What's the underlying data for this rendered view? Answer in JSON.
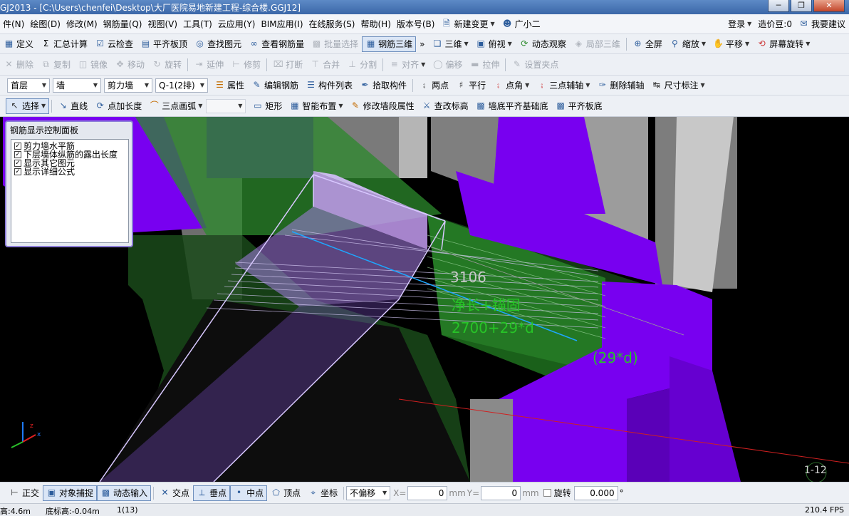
{
  "window": {
    "title": "GJ2013 - [C:\\Users\\chenfei\\Desktop\\大厂医院易地新建工程-综合楼.GGJ12]"
  },
  "menu": {
    "items": [
      "件(N)",
      "绘图(D)",
      "修改(M)",
      "钢筋量(Q)",
      "视图(V)",
      "工具(T)",
      "云应用(Y)",
      "BIM应用(I)",
      "在线服务(S)",
      "帮助(H)",
      "版本号(B)"
    ],
    "new_change": "新建变更",
    "xiaoer": "广小二",
    "login": "登录",
    "cost_beans": "造价豆:0",
    "want_suggest": "我要建议"
  },
  "toolbar1": {
    "define": "定义",
    "sum_calc": "汇总计算",
    "cloud_check": "云检查",
    "flush_top": "平齐板顶",
    "find_element": "查找图元",
    "view_rebar": "查看钢筋量",
    "batch_select": "批量选择",
    "rebar_3d": "钢筋三维",
    "more": "»",
    "three_d": "三维",
    "top_view": "俯视",
    "dynamic_view": "动态观察",
    "local_3d": "局部三维",
    "fullscreen": "全屏",
    "zoom": "缩放",
    "pan": "平移",
    "screen_rotate": "屏幕旋转"
  },
  "toolbar2": {
    "delete": "删除",
    "copy": "复制",
    "mirror": "镜像",
    "move": "移动",
    "rotate": "旋转",
    "extend": "延伸",
    "trim": "修剪",
    "break": "打断",
    "merge": "合并",
    "split": "分割",
    "align": "对齐",
    "offset": "偏移",
    "stretch": "拉伸",
    "set_grip": "设置夹点"
  },
  "toolbar3": {
    "floor": "首层",
    "category": "墙",
    "type": "剪力墙",
    "element": "Q-1(2排)",
    "property": "属性",
    "edit_rebar": "编辑钢筋",
    "element_list": "构件列表",
    "pick_element": "拾取构件",
    "two_points": "两点",
    "parallel": "平行",
    "point_angle": "点角",
    "three_point_axis": "三点辅轴",
    "delete_axis": "删除辅轴",
    "dimension": "尺寸标注"
  },
  "toolbar4": {
    "select": "选择",
    "line": "直线",
    "point_length": "点加长度",
    "three_point_arc": "三点画弧",
    "rect": "矩形",
    "smart_layout": "智能布置",
    "modify_segment": "修改墙段属性",
    "check_elevation": "查改标高",
    "wall_bottom_align": "墙底平齐基础底",
    "align_slab_bottom": "平齐板底"
  },
  "control_panel": {
    "title": "钢筋显示控制面板",
    "options": [
      {
        "label": "剪力墙水平筋",
        "checked": true
      },
      {
        "label": "下层墙体纵筋的露出长度",
        "checked": true
      },
      {
        "label": "显示其它图元",
        "checked": true
      },
      {
        "label": "显示详细公式",
        "checked": true
      }
    ]
  },
  "viewport": {
    "len_value": "3106",
    "formula_name": "净长+锚固",
    "formula_value": "2700+29*d",
    "anchor_label": "(29*d)",
    "view_id": "1-12"
  },
  "snapbar": {
    "ortho": "正交",
    "object_snap": "对象捕捉",
    "dynamic_input": "动态输入",
    "intersection": "交点",
    "perpendicular": "垂点",
    "midpoint": "中点",
    "vertex": "顶点",
    "coordinate": "坐标",
    "offset_mode": "不偏移",
    "x_label": "X=",
    "x_value": "0",
    "x_unit": "mm",
    "y_label": "Y=",
    "y_value": "0",
    "y_unit": "mm",
    "rotate": "旋转",
    "rotate_value": "0.000",
    "deg": "°"
  },
  "status": {
    "height": "高:4.6m",
    "bottom_elev": "底标高:-0.04m",
    "count": "1(13)",
    "fps": "210.4 FPS"
  },
  "colors": {
    "wall_purple": "#7800f0",
    "green_wall": "#2c8a2c",
    "highlight": "#c39bf0",
    "label_gray": "#c8c8c8",
    "label_green": "#27c427",
    "background": "#000000"
  }
}
